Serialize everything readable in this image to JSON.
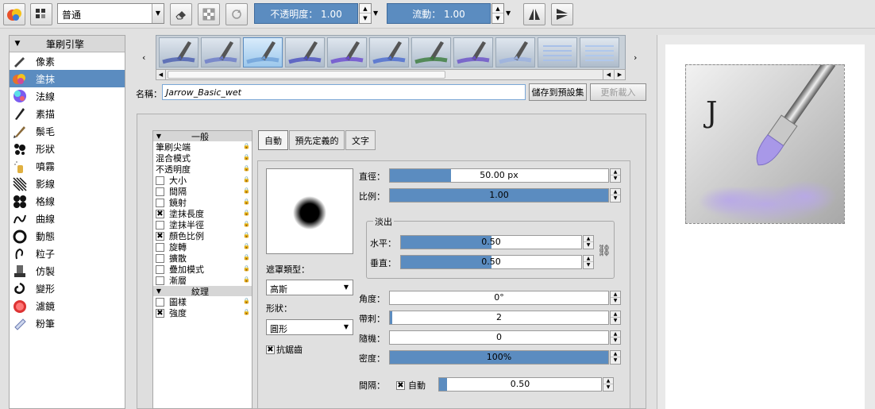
{
  "toolbar": {
    "blend_mode": "普通",
    "opacity_label": "不透明度：  1.00",
    "flow_label": "流動：  1.00",
    "icons": [
      "color-palette-icon",
      "brush-grid-icon",
      "eraser-icon",
      "checker-alpha-icon",
      "reload-icon",
      "mirror-horizontal-icon",
      "mirror-vertical-icon"
    ]
  },
  "engine_panel": {
    "header": "筆刷引擎",
    "items": [
      {
        "label": "像素",
        "icon": "pixel-brush-icon"
      },
      {
        "label": "塗抹",
        "icon": "smudge-icon",
        "selected": true
      },
      {
        "label": "法線",
        "icon": "normal-icon"
      },
      {
        "label": "素描",
        "icon": "sketch-icon"
      },
      {
        "label": "鬃毛",
        "icon": "bristle-icon"
      },
      {
        "label": "形狀",
        "icon": "shape-icon"
      },
      {
        "label": "噴霧",
        "icon": "spray-icon"
      },
      {
        "label": "影線",
        "icon": "hatching-icon"
      },
      {
        "label": "格線",
        "icon": "grid-icon"
      },
      {
        "label": "曲線",
        "icon": "curve-icon"
      },
      {
        "label": "動態",
        "icon": "dynamic-icon"
      },
      {
        "label": "粒子",
        "icon": "particle-icon"
      },
      {
        "label": "仿製",
        "icon": "clone-icon"
      },
      {
        "label": "變形",
        "icon": "deform-icon"
      },
      {
        "label": "濾鏡",
        "icon": "filter-icon"
      },
      {
        "label": "粉筆",
        "icon": "chalk-icon"
      }
    ]
  },
  "presets": {
    "prev": "‹",
    "next": "›",
    "count": 11,
    "selected_index": 2
  },
  "name_row": {
    "label": "名稱：",
    "value": "Jarrow_Basic_wet",
    "save_button": "儲存到預設集",
    "reload_button": "更新載入"
  },
  "options_tree": {
    "general_header": "一般",
    "general_items": [
      {
        "label": "筆刷尖端",
        "checkbox": false
      },
      {
        "label": "混合模式",
        "checkbox": false
      },
      {
        "label": "不透明度",
        "checkbox": false
      },
      {
        "label": "大小",
        "checkbox": true,
        "checked": false
      },
      {
        "label": "間隔",
        "checkbox": true,
        "checked": false
      },
      {
        "label": "鏡射",
        "checkbox": true,
        "checked": false
      },
      {
        "label": "塗抹長度",
        "checkbox": true,
        "checked": true
      },
      {
        "label": "塗抹半徑",
        "checkbox": true,
        "checked": false
      },
      {
        "label": "顏色比例",
        "checkbox": true,
        "checked": true
      },
      {
        "label": "旋轉",
        "checkbox": true,
        "checked": false
      },
      {
        "label": "擴散",
        "checkbox": true,
        "checked": false
      },
      {
        "label": "疊加模式",
        "checkbox": true,
        "checked": false
      },
      {
        "label": "漸層",
        "checkbox": true,
        "checked": false
      }
    ],
    "texture_header": "紋理",
    "texture_items": [
      {
        "label": "圖樣",
        "checkbox": true,
        "checked": false
      },
      {
        "label": "強度",
        "checkbox": true,
        "checked": true
      }
    ]
  },
  "tabs": [
    "自動",
    "預先定義的",
    "文字"
  ],
  "tip": {
    "mask_type_label": "遮罩類型：",
    "mask_type_value": "高斯",
    "shape_label": "形狀：",
    "shape_value": "圓形",
    "antialias_label": "抗鋸齒",
    "antialias_checked": true
  },
  "params": {
    "diameter": {
      "label": "直徑：",
      "value": "50.00 px",
      "fill": 0.28
    },
    "ratio": {
      "label": "比例：",
      "value": "1.00",
      "fill": 1.0
    },
    "fade_title": "淡出",
    "fade_h": {
      "label": "水平：",
      "value": "0.50",
      "fill": 0.5
    },
    "fade_v": {
      "label": "垂直：",
      "value": "0.50",
      "fill": 0.5
    },
    "angle": {
      "label": "角度：",
      "value": "0°",
      "fill": 0.0
    },
    "spikes": {
      "label": "帶刺：",
      "value": "2",
      "fill": 0.01
    },
    "random": {
      "label": "隨機：",
      "value": "0",
      "fill": 0.0
    },
    "density": {
      "label": "密度：",
      "value": "100%",
      "fill": 1.0
    },
    "spacing": {
      "label": "間隔：",
      "auto_label": "自動",
      "auto_checked": true,
      "value": "0.50",
      "fill": 0.05
    }
  },
  "canvas_preview": {
    "letter": "J"
  }
}
